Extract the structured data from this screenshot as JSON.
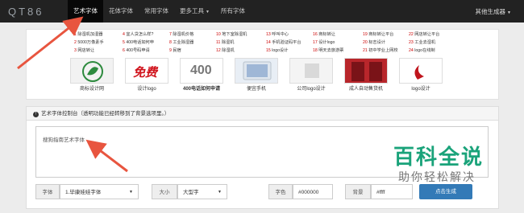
{
  "navbar": {
    "logo": "QT86",
    "items": [
      "艺术字体",
      "花体字体",
      "常用字体",
      "更多工具",
      "所有字体"
    ],
    "right": "其他生成器"
  },
  "links": [
    {
      "n": "1",
      "t": "除湿机加湿器"
    },
    {
      "n": "4",
      "t": "宜人贷怎么样?"
    },
    {
      "n": "7",
      "t": "除湿机价格"
    },
    {
      "n": "10",
      "t": "地下室除湿机"
    },
    {
      "n": "13",
      "t": "呼叫中心"
    },
    {
      "n": "16",
      "t": "商标转让"
    },
    {
      "n": "19",
      "t": "商标转让平台"
    },
    {
      "n": "22",
      "t": "网店转让平台"
    },
    {
      "n": "2",
      "t": "5000万像素手"
    },
    {
      "n": "5",
      "t": "400电话如何申"
    },
    {
      "n": "8",
      "t": "工业除湿器"
    },
    {
      "n": "11",
      "t": "除湿机"
    },
    {
      "n": "14",
      "t": "手机验证码平台"
    },
    {
      "n": "17",
      "t": "设计logo"
    },
    {
      "n": "20",
      "t": "标志设计"
    },
    {
      "n": "23",
      "t": "工业去湿机"
    },
    {
      "n": "3",
      "t": "网店转让"
    },
    {
      "n": "6",
      "t": "400号码申请"
    },
    {
      "n": "9",
      "t": "民宿"
    },
    {
      "n": "12",
      "t": "除湿机"
    },
    {
      "n": "15",
      "t": "logo设计"
    },
    {
      "n": "18",
      "t": "明天去旅游票"
    },
    {
      "n": "21",
      "t": "初中学业上网校"
    },
    {
      "n": "24",
      "t": "logo在线制"
    }
  ],
  "thumbs": [
    {
      "cap": "商标设计网",
      "icon": "leaf-logo"
    },
    {
      "cap": "设计logo",
      "icon": "free-stamp"
    },
    {
      "cap": "400电话如何申请",
      "icon": "400-text"
    },
    {
      "cap": "便宜手机",
      "icon": "phone"
    },
    {
      "cap": "公司logo设计",
      "icon": "logo"
    },
    {
      "cap": "成人自动售货机",
      "icon": "vending"
    },
    {
      "cap": "logo设计",
      "icon": "brand-logo"
    }
  ],
  "thumb_free": "免费",
  "thumb_400": "400",
  "control": {
    "header": "艺术字体控制台（透明功能已经转移到了背景选项里。）",
    "text": "搜狗指南艺术字体",
    "font_label": "字体",
    "font_value": "1.毕康娃娃字体",
    "size_label": "大小",
    "size_value": "大型字",
    "color_label": "字色",
    "color_value": "#000000",
    "bg_label": "背景",
    "bg_value": "#ffff",
    "generate": "点击生成"
  },
  "watermark": {
    "big": "百科全说",
    "small": "助你轻松解决"
  }
}
